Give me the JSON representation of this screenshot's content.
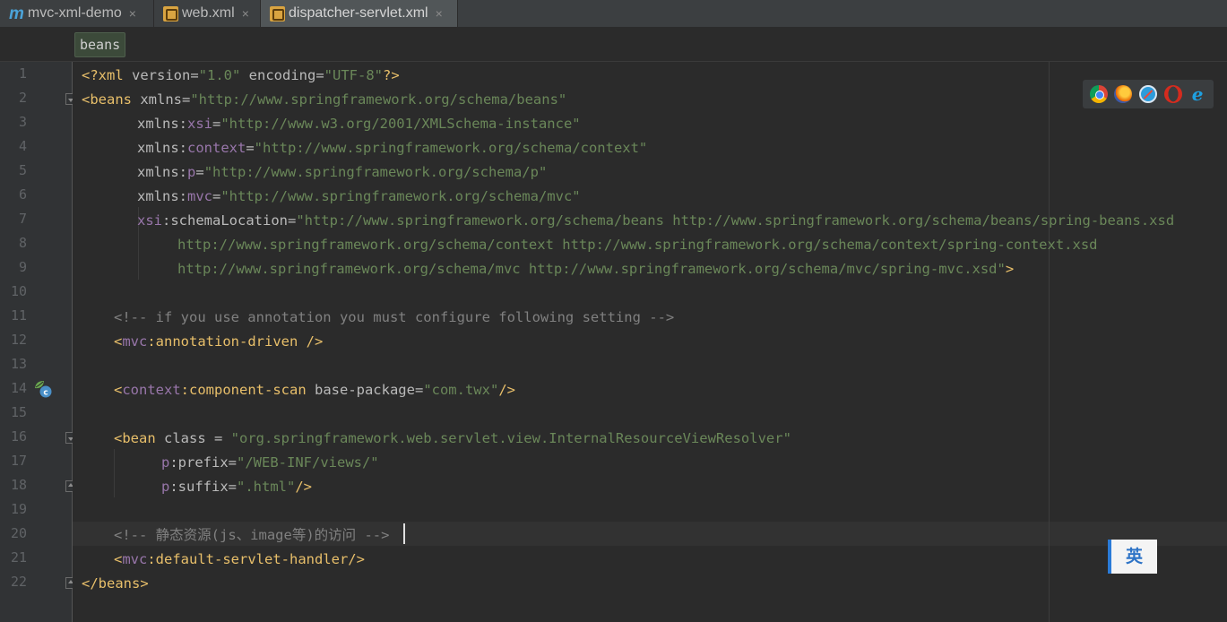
{
  "tabs": [
    {
      "label": "mvc-xml-demo",
      "icon": "maven-module-icon",
      "active": false
    },
    {
      "label": "web.xml",
      "icon": "xml-file-icon",
      "active": false
    },
    {
      "label": "dispatcher-servlet.xml",
      "icon": "xml-file-icon",
      "active": true
    }
  ],
  "tab_close_glyph": "×",
  "breadcrumb": "beans",
  "line_numbers": [
    "1",
    "2",
    "3",
    "4",
    "5",
    "6",
    "7",
    "8",
    "9",
    "10",
    "11",
    "12",
    "13",
    "14",
    "15",
    "16",
    "17",
    "18",
    "19",
    "20",
    "21",
    "22"
  ],
  "code": {
    "l1": {
      "a": "<?xml",
      "b": " version=",
      "c": "\"1.0\"",
      "d": " encoding=",
      "e": "\"UTF-8\"",
      "f": "?>"
    },
    "l2": {
      "a": "<beans",
      "b": " xmlns=",
      "c": "\"http://www.springframework.org/schema/beans\""
    },
    "l3": {
      "a": "xmlns:",
      "b": "xsi",
      "c": "=",
      "d": "\"http://www.w3.org/2001/XMLSchema-instance\""
    },
    "l4": {
      "a": "xmlns:",
      "b": "context",
      "c": "=",
      "d": "\"http://www.springframework.org/schema/context\""
    },
    "l5": {
      "a": "xmlns:",
      "b": "p",
      "c": "=",
      "d": "\"http://www.springframework.org/schema/p\""
    },
    "l6": {
      "a": "xmlns:",
      "b": "mvc",
      "c": "=",
      "d": "\"http://www.springframework.org/schema/mvc\""
    },
    "l7": {
      "a": "xsi",
      "b": ":schemaLocation=",
      "c": "\"http://www.springframework.org/schema/beans http://www.springframework.org/schema/beans/spring-beans.xsd"
    },
    "l8": {
      "a": "http://www.springframework.org/schema/context http://www.springframework.org/schema/context/spring-context.xsd"
    },
    "l9": {
      "a": "http://www.springframework.org/schema/mvc http://www.springframework.org/schema/mvc/spring-mvc.xsd\"",
      "b": ">"
    },
    "l11": {
      "a": "<!-- if you use annotation you must configure following setting -->"
    },
    "l12": {
      "a": "<",
      "b": "mvc",
      "c": ":annotation-driven />"
    },
    "l14": {
      "a": "<",
      "b": "context",
      "c": ":component-scan",
      "d": " base-package=",
      "e": "\"com.twx\"",
      "f": "/>"
    },
    "l16": {
      "a": "<bean",
      "b": " class = ",
      "c": "\"org.springframework.web.servlet.view.InternalResourceViewResolver\""
    },
    "l17": {
      "a": "p",
      "b": ":prefix=",
      "c": "\"/WEB-INF/views/\""
    },
    "l18": {
      "a": "p",
      "b": ":suffix=",
      "c": "\".html\"",
      "d": "/>"
    },
    "l20": {
      "a": "<!-- 静态资源(js、image等)的访问 -->"
    },
    "l21": {
      "a": "<",
      "b": "mvc",
      "c": ":default-servlet-handler/>"
    },
    "l22": {
      "a": "</beans>"
    }
  },
  "browser_icons": [
    "chrome-icon",
    "firefox-icon",
    "safari-icon",
    "opera-icon",
    "ie-icon"
  ],
  "ime_indicator": "英",
  "colors": {
    "background": "#2b2b2b",
    "tag": "#e8bf6a",
    "string": "#6a8759",
    "namespace": "#9876aa",
    "comment": "#808080"
  }
}
